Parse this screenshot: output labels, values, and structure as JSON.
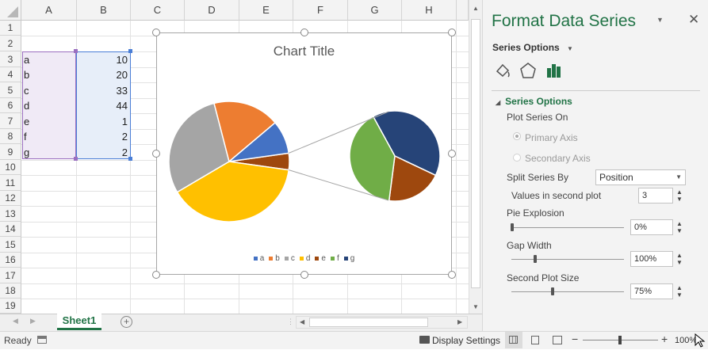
{
  "columns": [
    "A",
    "B",
    "C",
    "D",
    "E",
    "F",
    "G",
    "H"
  ],
  "rows": [
    "1",
    "2",
    "3",
    "4",
    "5",
    "6",
    "7",
    "8",
    "9",
    "10",
    "11",
    "12",
    "13",
    "14",
    "15",
    "16",
    "17",
    "18",
    "19"
  ],
  "cells": {
    "a3": "a",
    "b3": "10",
    "a4": "b",
    "b4": "20",
    "a5": "c",
    "b5": "33",
    "a6": "d",
    "b6": "44",
    "a7": "e",
    "b7": "1",
    "a8": "f",
    "b8": "2",
    "a9": "g",
    "b9": "2"
  },
  "chart_data": {
    "type": "pie",
    "subtype": "pie-of-pie",
    "title": "Chart Title",
    "categories": [
      "a",
      "b",
      "c",
      "d",
      "e",
      "f",
      "g"
    ],
    "values": [
      10,
      20,
      33,
      44,
      1,
      2,
      2
    ],
    "colors": [
      "#4472c4",
      "#ed7d31",
      "#a5a5a5",
      "#ffc000",
      "#9e480e",
      "#70ad47",
      "#264478"
    ],
    "legend": "bottom"
  },
  "legend_labels": [
    "a",
    "b",
    "c",
    "d",
    "e",
    "f",
    "g"
  ],
  "sheet_tab": "Sheet1",
  "status": {
    "ready": "Ready",
    "display_settings": "Display Settings",
    "zoom": "100%"
  },
  "pane": {
    "title": "Format Data Series",
    "series_options_dropdown": "Series Options",
    "section": "Series Options",
    "plot_on": "Plot Series On",
    "primary_axis": "Primary Axis",
    "secondary_axis": "Secondary Axis",
    "split_by_label": "Split Series By",
    "split_by_value": "Position",
    "values_second_label": "Values in second plot",
    "values_second_value": "3",
    "explosion_label": "Pie Explosion",
    "explosion_value": "0%",
    "gap_label": "Gap Width",
    "gap_value": "100%",
    "second_size_label": "Second Plot Size",
    "second_size_value": "75%"
  }
}
